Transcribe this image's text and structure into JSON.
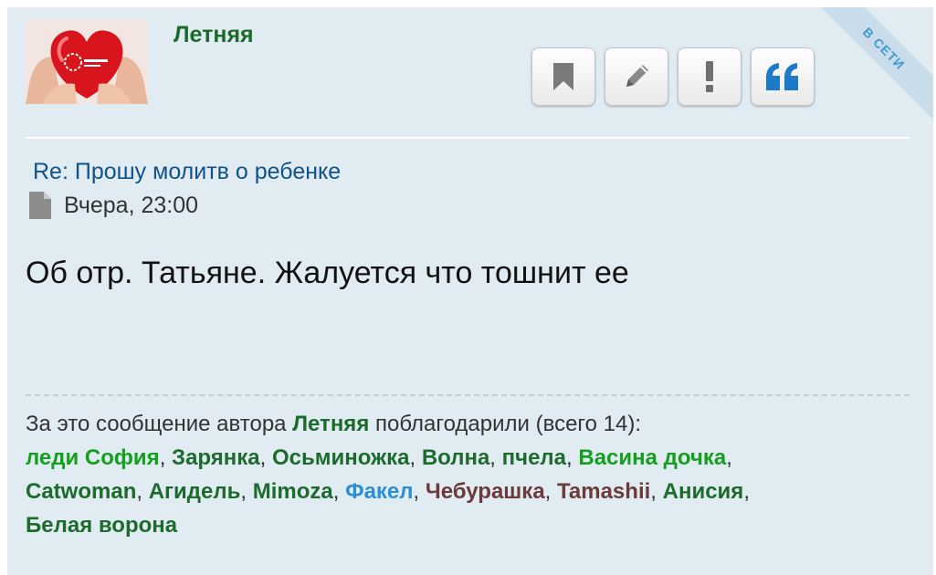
{
  "author": {
    "name": "Летняя"
  },
  "online_badge": "В СЕТИ",
  "buttons": [
    {
      "icon": "bookmark-icon"
    },
    {
      "icon": "pencil-icon"
    },
    {
      "icon": "exclamation-icon"
    },
    {
      "icon": "quote-icon"
    }
  ],
  "post": {
    "subject": "Re: Прошу молитв о ребенке",
    "time": "Вчера, 23:00",
    "content": "Об отр. Татьяне. Жалуется что тошнит ее"
  },
  "thanks": {
    "prefix": "За это сообщение автора",
    "author": "Летняя",
    "suffix": "поблагодарили (всего 14):",
    "users": [
      {
        "name": "леди София",
        "color": "#14a01e"
      },
      {
        "name": "Зарянка",
        "color": "#1c6b2d"
      },
      {
        "name": "Осьминожка",
        "color": "#1c6b2d"
      },
      {
        "name": "Волна",
        "color": "#1c6b2d"
      },
      {
        "name": "пчела",
        "color": "#1c6b2d"
      },
      {
        "name": "Васина дочка",
        "color": "#14a01e"
      },
      {
        "name": "Catwoman",
        "color": "#1c6b2d"
      },
      {
        "name": "Агидель",
        "color": "#1c6b2d"
      },
      {
        "name": "Mimoza",
        "color": "#1c6b2d"
      },
      {
        "name": "Факел",
        "color": "#2b8fd1"
      },
      {
        "name": "Чебурашка",
        "color": "#6b3a3a"
      },
      {
        "name": "Tamashii",
        "color": "#6b3a3a"
      },
      {
        "name": "Анисия",
        "color": "#1c6b2d"
      },
      {
        "name": "Белая ворона",
        "color": "#1c6b2d"
      }
    ]
  }
}
